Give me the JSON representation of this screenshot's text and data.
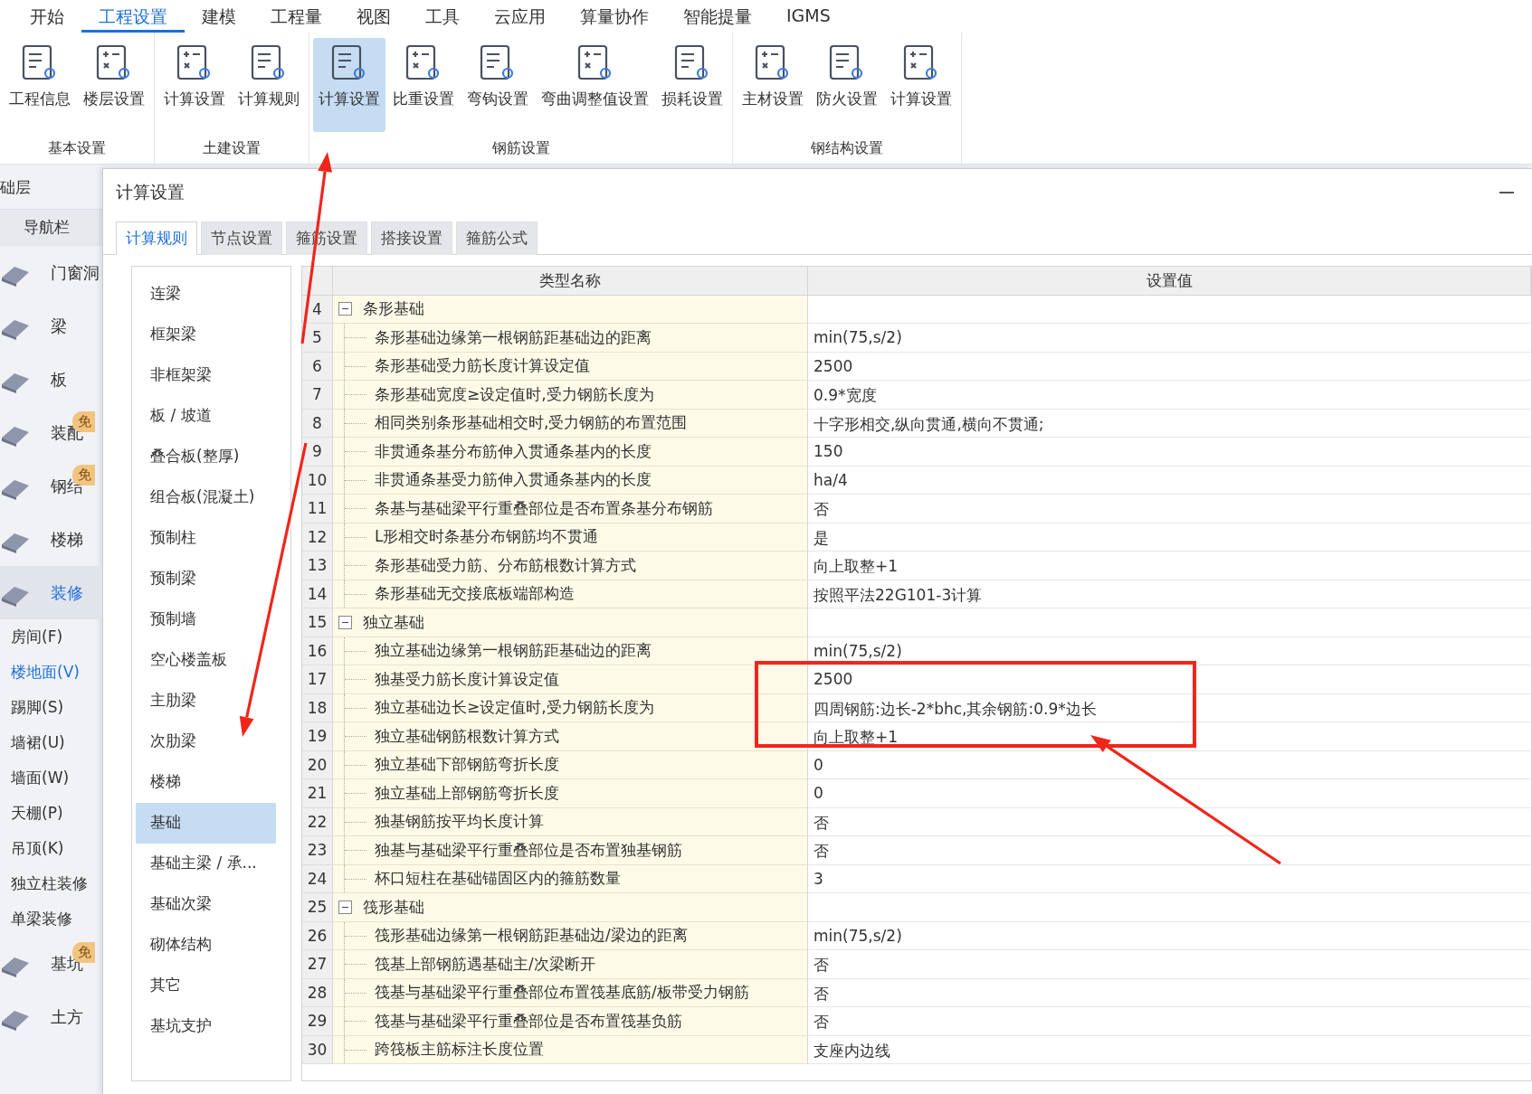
{
  "menu_tabs": [
    {
      "label": "开始",
      "selected": false
    },
    {
      "label": "工程设置",
      "selected": true
    },
    {
      "label": "建模",
      "selected": false
    },
    {
      "label": "工程量",
      "selected": false
    },
    {
      "label": "视图",
      "selected": false
    },
    {
      "label": "工具",
      "selected": false
    },
    {
      "label": "云应用",
      "selected": false
    },
    {
      "label": "算量协作",
      "selected": false
    },
    {
      "label": "智能提量",
      "selected": false
    },
    {
      "label": "IGMS",
      "selected": false
    }
  ],
  "ribbon_groups": [
    {
      "title": "基本设置",
      "buttons": [
        {
          "label": "工程信息",
          "selected": false
        },
        {
          "label": "楼层设置",
          "selected": false
        }
      ]
    },
    {
      "title": "土建设置",
      "buttons": [
        {
          "label": "计算设置",
          "selected": false
        },
        {
          "label": "计算规则",
          "selected": false
        }
      ]
    },
    {
      "title": "钢筋设置",
      "buttons": [
        {
          "label": "计算设置",
          "selected": true
        },
        {
          "label": "比重设置",
          "selected": false
        },
        {
          "label": "弯钩设置",
          "selected": false
        },
        {
          "label": "弯曲调整值设置",
          "selected": false
        },
        {
          "label": "损耗设置",
          "selected": false
        }
      ]
    },
    {
      "title": "钢结构设置",
      "buttons": [
        {
          "label": "主材设置",
          "selected": false
        },
        {
          "label": "防火设置",
          "selected": false
        },
        {
          "label": "计算设置",
          "selected": false
        }
      ]
    }
  ],
  "nav": {
    "floor": "础层",
    "title": "导航栏",
    "items": [
      {
        "label": "门窗洞",
        "selected": false
      },
      {
        "label": "梁",
        "selected": false
      },
      {
        "label": "板",
        "selected": false
      },
      {
        "label": "装配",
        "selected": false,
        "badge": "免"
      },
      {
        "label": "钢结",
        "selected": false,
        "badge": "免"
      },
      {
        "label": "楼梯",
        "selected": false
      },
      {
        "label": "装修",
        "selected": true,
        "children": [
          {
            "label": "房间(F)",
            "selected": false
          },
          {
            "label": "楼地面(V)",
            "selected": true
          },
          {
            "label": "踢脚(S)",
            "selected": false
          },
          {
            "label": "墙裙(U)",
            "selected": false
          },
          {
            "label": "墙面(W)",
            "selected": false
          },
          {
            "label": "天棚(P)",
            "selected": false
          },
          {
            "label": "吊顶(K)",
            "selected": false
          },
          {
            "label": "独立柱装修",
            "selected": false
          },
          {
            "label": "单梁装修",
            "selected": false
          }
        ]
      },
      {
        "label": "基坑",
        "selected": false,
        "badge": "免"
      },
      {
        "label": "土方",
        "selected": false
      }
    ]
  },
  "dialog": {
    "title": "计算设置",
    "tabs": [
      {
        "label": "计算规则",
        "selected": true
      },
      {
        "label": "节点设置",
        "selected": false
      },
      {
        "label": "箍筋设置",
        "selected": false
      },
      {
        "label": "搭接设置",
        "selected": false
      },
      {
        "label": "箍筋公式",
        "selected": false
      }
    ],
    "categories": [
      {
        "label": "连梁",
        "selected": false
      },
      {
        "label": "框架梁",
        "selected": false
      },
      {
        "label": "非框架梁",
        "selected": false
      },
      {
        "label": "板 / 坡道",
        "selected": false
      },
      {
        "label": "叠合板(整厚)",
        "selected": false
      },
      {
        "label": "组合板(混凝土)",
        "selected": false
      },
      {
        "label": "预制柱",
        "selected": false
      },
      {
        "label": "预制梁",
        "selected": false
      },
      {
        "label": "预制墙",
        "selected": false
      },
      {
        "label": "空心楼盖板",
        "selected": false
      },
      {
        "label": "主肋梁",
        "selected": false
      },
      {
        "label": "次肋梁",
        "selected": false
      },
      {
        "label": "楼梯",
        "selected": false
      },
      {
        "label": "基础",
        "selected": true
      },
      {
        "label": "基础主梁 / 承...",
        "selected": false
      },
      {
        "label": "基础次梁",
        "selected": false
      },
      {
        "label": "砌体结构",
        "selected": false
      },
      {
        "label": "其它",
        "selected": false
      },
      {
        "label": "基坑支护",
        "selected": false
      }
    ],
    "table": {
      "columns": [
        "类型名称",
        "设置值"
      ],
      "rows": [
        {
          "kind": "group",
          "number": "4",
          "name": "条形基础",
          "expanded": true
        },
        {
          "kind": "item",
          "number": "5",
          "name": "条形基础边缘第一根钢筋距基础边的距离",
          "value": "min(75,s/2)"
        },
        {
          "kind": "item",
          "number": "6",
          "name": "条形基础受力筋长度计算设定值",
          "value": "2500"
        },
        {
          "kind": "item",
          "number": "7",
          "name": "条形基础宽度≥设定值时,受力钢筋长度为",
          "value": "0.9*宽度"
        },
        {
          "kind": "item",
          "number": "8",
          "name": "相同类别条形基础相交时,受力钢筋的布置范围",
          "value": "十字形相交,纵向贯通,横向不贯通;"
        },
        {
          "kind": "item",
          "number": "9",
          "name": "非贯通条基分布筋伸入贯通条基内的长度",
          "value": "150"
        },
        {
          "kind": "item",
          "number": "10",
          "name": "非贯通条基受力筋伸入贯通条基内的长度",
          "value": "ha/4"
        },
        {
          "kind": "item",
          "number": "11",
          "name": "条基与基础梁平行重叠部位是否布置条基分布钢筋",
          "value": "否"
        },
        {
          "kind": "item",
          "number": "12",
          "name": "L形相交时条基分布钢筋均不贯通",
          "value": "是"
        },
        {
          "kind": "item",
          "number": "13",
          "name": "条形基础受力筋、分布筋根数计算方式",
          "value": "向上取整+1"
        },
        {
          "kind": "item",
          "number": "14",
          "name": "条形基础无交接底板端部构造",
          "value": "按照平法22G101-3计算"
        },
        {
          "kind": "group",
          "number": "15",
          "name": "独立基础",
          "expanded": true
        },
        {
          "kind": "item",
          "number": "16",
          "name": "独立基础边缘第一根钢筋距基础边的距离",
          "value": "min(75,s/2)"
        },
        {
          "kind": "item",
          "number": "17",
          "name": "独基受力筋长度计算设定值",
          "value": "2500"
        },
        {
          "kind": "item",
          "number": "18",
          "name": "独立基础边长≥设定值时,受力钢筋长度为",
          "value": "四周钢筋:边长-2*bhc,其余钢筋:0.9*边长"
        },
        {
          "kind": "item",
          "number": "19",
          "name": "独立基础钢筋根数计算方式",
          "value": "向上取整+1"
        },
        {
          "kind": "item",
          "number": "20",
          "name": "独立基础下部钢筋弯折长度",
          "value": "0"
        },
        {
          "kind": "item",
          "number": "21",
          "name": "独立基础上部钢筋弯折长度",
          "value": "0"
        },
        {
          "kind": "item",
          "number": "22",
          "name": "独基钢筋按平均长度计算",
          "value": "否"
        },
        {
          "kind": "item",
          "number": "23",
          "name": "独基与基础梁平行重叠部位是否布置独基钢筋",
          "value": "否"
        },
        {
          "kind": "item",
          "number": "24",
          "name": "杯口短柱在基础锚固区内的箍筋数量",
          "value": "3"
        },
        {
          "kind": "group",
          "number": "25",
          "name": "筏形基础",
          "expanded": true
        },
        {
          "kind": "item",
          "number": "26",
          "name": "筏形基础边缘第一根钢筋距基础边/梁边的距离",
          "value": "min(75,s/2)"
        },
        {
          "kind": "item",
          "number": "27",
          "name": "筏基上部钢筋遇基础主/次梁断开",
          "value": "否"
        },
        {
          "kind": "item",
          "number": "28",
          "name": "筏基与基础梁平行重叠部位布置筏基底筋/板带受力钢筋",
          "value": "否"
        },
        {
          "kind": "item",
          "number": "29",
          "name": "筏基与基础梁平行重叠部位是否布置筏基负筋",
          "value": "否"
        },
        {
          "kind": "item",
          "number": "30",
          "name": "跨筏板主筋标注长度位置",
          "value": "支座内边线"
        }
      ]
    }
  }
}
